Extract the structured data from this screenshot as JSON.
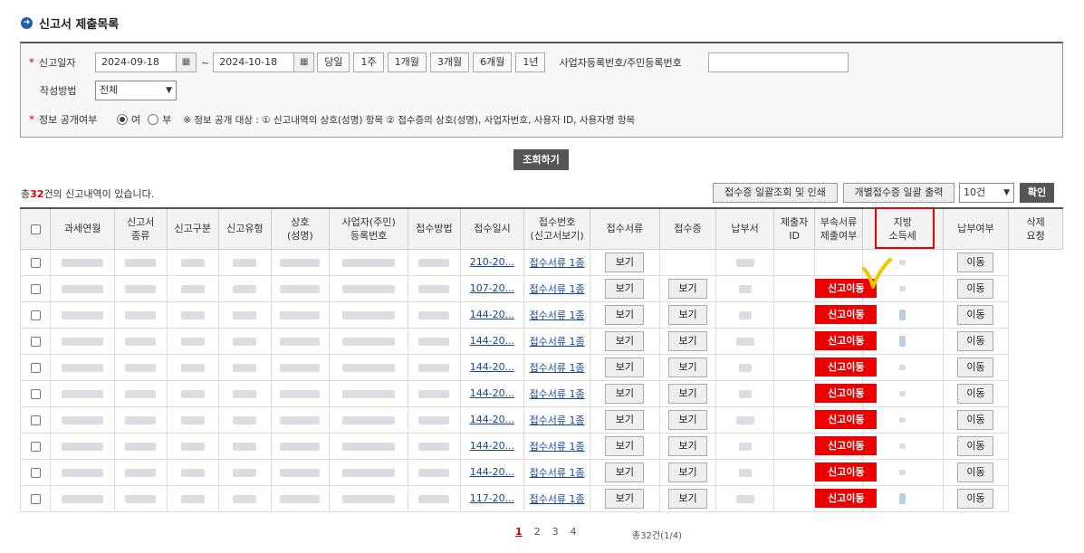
{
  "page": {
    "title": "신고서 제출목록"
  },
  "search": {
    "date_label": "신고일자",
    "date_from": "2024-09-18",
    "date_to": "2024-10-18",
    "range_sep": "~",
    "period_buttons": [
      "당일",
      "1주",
      "1개월",
      "3개월",
      "6개월",
      "1년"
    ],
    "biz_no_label": "사업자등록번호/주민등록번호",
    "biz_no_value": "",
    "method_label": "작성방법",
    "method_value": "전체",
    "disclose_label": "정보 공개여부",
    "disclose_yes": "여",
    "disclose_no": "부",
    "disclose_selected": "여",
    "disclose_note": "※ 정보 공개 대상 : ① 신고내역의 상호(성명) 항목 ② 접수증의 상호(성명), 사업자번호, 사용자 ID, 사용자명 항목",
    "submit_label": "조회하기"
  },
  "toolbar": {
    "total_prefix": "총",
    "total_count": "32",
    "total_suffix": "건의 신고내역이 있습니다.",
    "bulk_receipt_label": "접수증 일괄조회 및 인쇄",
    "individual_receipt_label": "개별접수증 일괄 출력",
    "page_size_value": "10건",
    "confirm_label": "확인"
  },
  "table": {
    "headers": [
      "과세연월",
      "신고서\n종류",
      "신고구분",
      "신고유형",
      "상호\n(성명)",
      "사업자(주민)\n등록번호",
      "접수방법",
      "접수일시",
      "접수번호\n(신고서보기)",
      "접수서류",
      "접수증",
      "납부서",
      "제출자\nID",
      "부속서류\n제출여부",
      "지방\n소득세",
      "납부여부",
      "삭제\n요청"
    ],
    "rows": [
      {
        "receipt_no": "210-20...",
        "docs": "접수서류 1종",
        "receipt_btn": "보기",
        "payment_btn": "",
        "local_tax_btn": "",
        "paid_blue": false,
        "delete_btn": "이동"
      },
      {
        "receipt_no": "107-20...",
        "docs": "접수서류 1종",
        "receipt_btn": "보기",
        "payment_btn": "보기",
        "local_tax_btn": "신고이동",
        "paid_blue": false,
        "delete_btn": "이동"
      },
      {
        "receipt_no": "144-20...",
        "docs": "접수서류 1종",
        "receipt_btn": "보기",
        "payment_btn": "보기",
        "local_tax_btn": "신고이동",
        "paid_blue": true,
        "delete_btn": "이동"
      },
      {
        "receipt_no": "144-20...",
        "docs": "접수서류 1종",
        "receipt_btn": "보기",
        "payment_btn": "보기",
        "local_tax_btn": "신고이동",
        "paid_blue": true,
        "delete_btn": "이동"
      },
      {
        "receipt_no": "144-20...",
        "docs": "접수서류 1종",
        "receipt_btn": "보기",
        "payment_btn": "보기",
        "local_tax_btn": "신고이동",
        "paid_blue": false,
        "delete_btn": "이동"
      },
      {
        "receipt_no": "144-20...",
        "docs": "접수서류 1종",
        "receipt_btn": "보기",
        "payment_btn": "보기",
        "local_tax_btn": "신고이동",
        "paid_blue": false,
        "delete_btn": "이동"
      },
      {
        "receipt_no": "144-20...",
        "docs": "접수서류 1종",
        "receipt_btn": "보기",
        "payment_btn": "보기",
        "local_tax_btn": "신고이동",
        "paid_blue": false,
        "delete_btn": "이동"
      },
      {
        "receipt_no": "144-20...",
        "docs": "접수서류 1종",
        "receipt_btn": "보기",
        "payment_btn": "보기",
        "local_tax_btn": "신고이동",
        "paid_blue": false,
        "delete_btn": "이동"
      },
      {
        "receipt_no": "144-20...",
        "docs": "접수서류 1종",
        "receipt_btn": "보기",
        "payment_btn": "보기",
        "local_tax_btn": "신고이동",
        "paid_blue": false,
        "delete_btn": "이동"
      },
      {
        "receipt_no": "117-20...",
        "docs": "접수서류 1종",
        "receipt_btn": "보기",
        "payment_btn": "보기",
        "local_tax_btn": "신고이동",
        "paid_blue": true,
        "delete_btn": "이동"
      }
    ]
  },
  "pagination": {
    "pages": [
      "1",
      "2",
      "3",
      "4"
    ],
    "current": "1",
    "summary": "총32건(1/4)"
  },
  "colors": {
    "accent_red": "#ee0000",
    "link_blue": "#15479b",
    "dark_button": "#555555"
  }
}
